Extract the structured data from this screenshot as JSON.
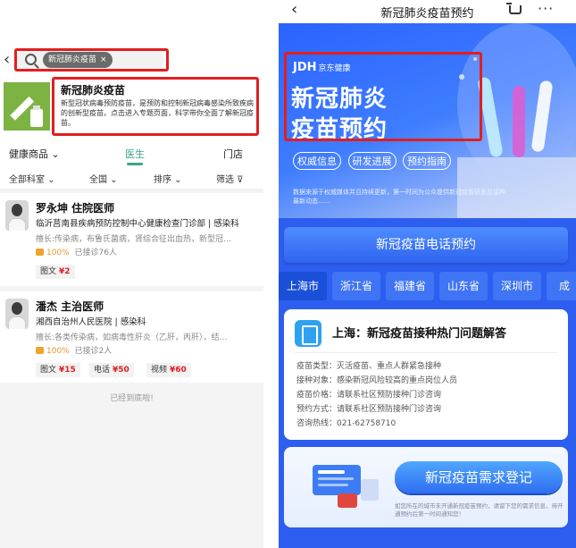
{
  "left": {
    "search": {
      "chip": "新冠肺炎疫苗",
      "chip_close": "×"
    },
    "topic": {
      "title": "新冠肺炎疫苗",
      "desc": "新型冠状病毒预防疫苗，是预防和控制新冠病毒感染所致疾病的创新型疫苗。点击进入专题页面，科学带你全面了解新冠疫苗。"
    },
    "tabs": [
      "健康商品",
      "医生",
      "门店"
    ],
    "filters": [
      "全部科室",
      "全国",
      "排序",
      "筛选"
    ],
    "doctors": [
      {
        "name": "罗永坤 住院医师",
        "org": "临沂莒南县疾病预防控制中心健康检查门诊部",
        "dept": "感染科",
        "spec": "擅长:传染病，布鲁氏菌病，肾综合征出血热，新型冠…",
        "rating": "100%",
        "consults": "已接诊76人",
        "services": [
          {
            "label": "图文",
            "price": "¥2"
          }
        ]
      },
      {
        "name": "潘杰 主治医师",
        "org": "湘西自治州人民医院",
        "dept": "感染科",
        "spec": "擅长:各类传染病，如病毒性肝炎（乙肝，丙肝），结…",
        "rating": "100%",
        "consults": "已接诊2人",
        "services": [
          {
            "label": "图文",
            "price": "¥15"
          },
          {
            "label": "电话",
            "price": "¥50"
          },
          {
            "label": "视频",
            "price": "¥60"
          }
        ]
      }
    ],
    "end_note": "已经到底啦!"
  },
  "right": {
    "nav_title": "新冠肺炎疫苗预约",
    "hero": {
      "logo": "JDH",
      "logo_sub": "京东健康",
      "title_line1": "新冠肺炎",
      "title_line2": "疫苗预约",
      "tags": [
        "权威信息",
        "研发进展",
        "预约指南"
      ],
      "note": "数据来源于权威媒体并且持续更新，第一时间为公众提供新冠疫苗研发及接种最新动态......"
    },
    "phone_title": "新冠疫苗电话预约",
    "cities": [
      "上海市",
      "浙江省",
      "福建省",
      "山东省",
      "深圳市",
      "成"
    ],
    "info": {
      "title": "上海：新冠疫苗接种热门问题解答",
      "lines": [
        "疫苗类型：灭活疫苗、重点人群紧急接种",
        "接种对象：感染新冠风险较高的重点岗位人员",
        "疫苗价格：请联系社区预防接种门诊咨询",
        "预约方式：请联系社区预防接种门诊咨询",
        "咨询热线：021-62758710"
      ]
    },
    "register_btn": "新冠疫苗需求登记",
    "register_note": "如您所在的城市未开通新冠疫苗预约，请留下您的需求信息，待开通预约后第一时间通知您！"
  },
  "colors": {
    "accent_green": "#3aa58e",
    "brand_blue": "#2d5ef0",
    "highlight_red": "#e21e1e",
    "price_red": "#e02020"
  }
}
